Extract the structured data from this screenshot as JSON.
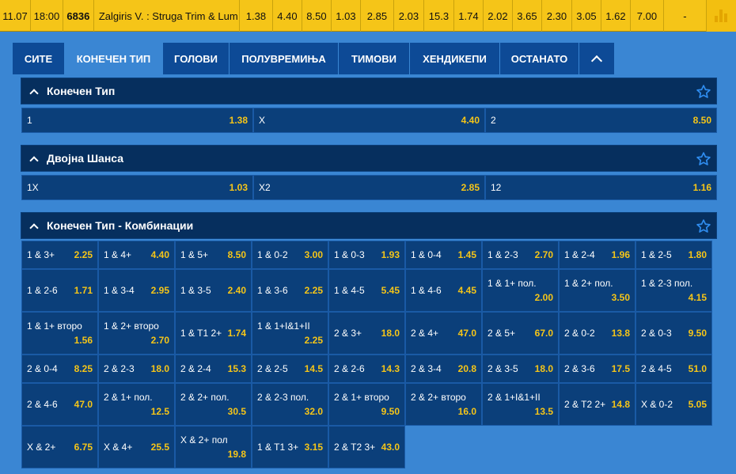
{
  "match": {
    "date": "11.07",
    "time": "18:00",
    "code": "6836",
    "teams": "Zalgiris V. : Struga Trim & Lum",
    "odds": [
      "1.38",
      "4.40",
      "8.50",
      "1.03",
      "2.85",
      "2.03",
      "15.3",
      "1.74",
      "2.02",
      "3.65",
      "2.30",
      "3.05",
      "1.62",
      "7.00",
      "-"
    ],
    "stats_icon": "bar-chart-icon"
  },
  "tabs": [
    {
      "label": "СИТЕ"
    },
    {
      "label": "КОНЕЧЕН ТИП"
    },
    {
      "label": "ГОЛОВИ"
    },
    {
      "label": "ПОЛУВРЕМИЊА"
    },
    {
      "label": "ТИМОВИ"
    },
    {
      "label": "ХЕНДИКЕПИ"
    },
    {
      "label": "ОСТАНАТО"
    }
  ],
  "sections": [
    {
      "title": "Конечен Тип",
      "odds": [
        {
          "label": "1",
          "value": "1.38"
        },
        {
          "label": "X",
          "value": "4.40"
        },
        {
          "label": "2",
          "value": "8.50"
        }
      ]
    },
    {
      "title": "Двојна Шанса",
      "odds": [
        {
          "label": "1X",
          "value": "1.03"
        },
        {
          "label": "X2",
          "value": "2.85"
        },
        {
          "label": "12",
          "value": "1.16"
        }
      ]
    },
    {
      "title": "Конечен Тип - Комбинации",
      "odds": [
        {
          "label": "1 & 3+",
          "value": "2.25"
        },
        {
          "label": "1 & 4+",
          "value": "4.40"
        },
        {
          "label": "1 & 5+",
          "value": "8.50"
        },
        {
          "label": "1 & 0-2",
          "value": "3.00"
        },
        {
          "label": "1 & 0-3",
          "value": "1.93"
        },
        {
          "label": "1 & 0-4",
          "value": "1.45"
        },
        {
          "label": "1 & 2-3",
          "value": "2.70"
        },
        {
          "label": "1 & 2-4",
          "value": "1.96"
        },
        {
          "label": "1 & 2-5",
          "value": "1.80"
        },
        {
          "label": "1 & 2-6",
          "value": "1.71"
        },
        {
          "label": "1 & 3-4",
          "value": "2.95"
        },
        {
          "label": "1 & 3-5",
          "value": "2.40"
        },
        {
          "label": "1 & 3-6",
          "value": "2.25"
        },
        {
          "label": "1 & 4-5",
          "value": "5.45"
        },
        {
          "label": "1 & 4-6",
          "value": "4.45"
        },
        {
          "label": "1 & 1+ пол.",
          "value": "2.00"
        },
        {
          "label": "1 & 2+ пол.",
          "value": "3.50"
        },
        {
          "label": "1 & 2-3 пол.",
          "value": "4.15"
        },
        {
          "label": "1 & 1+ второ",
          "value": "1.56"
        },
        {
          "label": "1 & 2+ второ",
          "value": "2.70"
        },
        {
          "label": "1 & T1 2+",
          "value": "1.74"
        },
        {
          "label": "1 & 1+I&1+II",
          "value": "2.25"
        },
        {
          "label": "2 & 3+",
          "value": "18.0"
        },
        {
          "label": "2 & 4+",
          "value": "47.0"
        },
        {
          "label": "2 & 5+",
          "value": "67.0"
        },
        {
          "label": "2 & 0-2",
          "value": "13.8"
        },
        {
          "label": "2 & 0-3",
          "value": "9.50"
        },
        {
          "label": "2 & 0-4",
          "value": "8.25"
        },
        {
          "label": "2 & 2-3",
          "value": "18.0"
        },
        {
          "label": "2 & 2-4",
          "value": "15.3"
        },
        {
          "label": "2 & 2-5",
          "value": "14.5"
        },
        {
          "label": "2 & 2-6",
          "value": "14.3"
        },
        {
          "label": "2 & 3-4",
          "value": "20.8"
        },
        {
          "label": "2 & 3-5",
          "value": "18.0"
        },
        {
          "label": "2 & 3-6",
          "value": "17.5"
        },
        {
          "label": "2 & 4-5",
          "value": "51.0"
        },
        {
          "label": "2 & 4-6",
          "value": "47.0"
        },
        {
          "label": "2 & 1+ пол.",
          "value": "12.5"
        },
        {
          "label": "2 & 2+ пол.",
          "value": "30.5"
        },
        {
          "label": "2 & 2-3 пол.",
          "value": "32.0"
        },
        {
          "label": "2 & 1+ второ",
          "value": "9.50"
        },
        {
          "label": "2 & 2+ второ",
          "value": "16.0"
        },
        {
          "label": "2 & 1+I&1+II",
          "value": "13.5"
        },
        {
          "label": "2 & T2 2+",
          "value": "14.8"
        },
        {
          "label": "X & 0-2",
          "value": "5.05"
        },
        {
          "label": "X & 2+",
          "value": "6.75"
        },
        {
          "label": "X & 4+",
          "value": "25.5"
        },
        {
          "label": "X & 2+ пол",
          "value": "19.8"
        },
        {
          "label": "1 & T1 3+",
          "value": "3.15"
        },
        {
          "label": "2 & T2 3+",
          "value": "43.0"
        }
      ]
    }
  ],
  "colors": {
    "accent": "#f5c518",
    "header": "#062f5e",
    "cell": "#0b3f7a",
    "page": "#3a86d3"
  }
}
